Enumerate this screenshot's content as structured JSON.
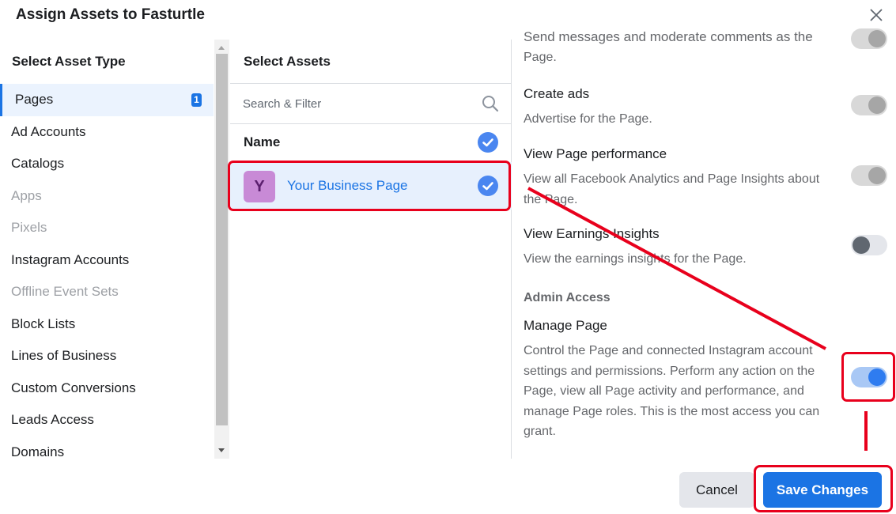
{
  "dialog": {
    "title": "Assign Assets to Fasturtle",
    "close_icon": "close-icon"
  },
  "asset_types": {
    "heading": "Select Asset Type",
    "items": [
      {
        "label": "Pages",
        "count": "1",
        "state": "active"
      },
      {
        "label": "Ad Accounts",
        "state": "enabled"
      },
      {
        "label": "Catalogs",
        "state": "enabled"
      },
      {
        "label": "Apps",
        "state": "disabled"
      },
      {
        "label": "Pixels",
        "state": "disabled"
      },
      {
        "label": "Instagram Accounts",
        "state": "enabled"
      },
      {
        "label": "Offline Event Sets",
        "state": "disabled"
      },
      {
        "label": "Block Lists",
        "state": "enabled"
      },
      {
        "label": "Lines of Business",
        "state": "enabled"
      },
      {
        "label": "Custom Conversions",
        "state": "enabled"
      },
      {
        "label": "Leads Access",
        "state": "enabled"
      },
      {
        "label": "Domains",
        "state": "enabled"
      }
    ]
  },
  "assets": {
    "heading": "Select Assets",
    "search_placeholder": "Search & Filter",
    "column_header": "Name",
    "rows": [
      {
        "avatar_letter": "Y",
        "name": "Your Business Page",
        "selected": true
      }
    ]
  },
  "permissions": {
    "partial_top_title": "Send messages and moderate comments as the",
    "partial_top_desc": "Page.",
    "items": [
      {
        "title": "Create ads",
        "desc": "Advertise for the Page.",
        "toggle": "on-disabled"
      },
      {
        "title": "View Page performance",
        "desc": "View all Facebook Analytics and Page Insights about the Page.",
        "toggle": "on-disabled"
      },
      {
        "title": "View Earnings Insights",
        "desc": "View the earnings insights for the Page.",
        "toggle": "off"
      }
    ],
    "admin_heading": "Admin Access",
    "admin_item": {
      "title": "Manage Page",
      "desc": "Control the Page and connected Instagram account settings and permissions. Perform any action on the Page, view all Page activity and performance, and manage Page roles. This is the most access you can grant.",
      "toggle": "on"
    }
  },
  "footer": {
    "cancel_label": "Cancel",
    "save_label": "Save Changes"
  },
  "colors": {
    "accent": "#1b74e4",
    "annotation": "#e8001c"
  }
}
